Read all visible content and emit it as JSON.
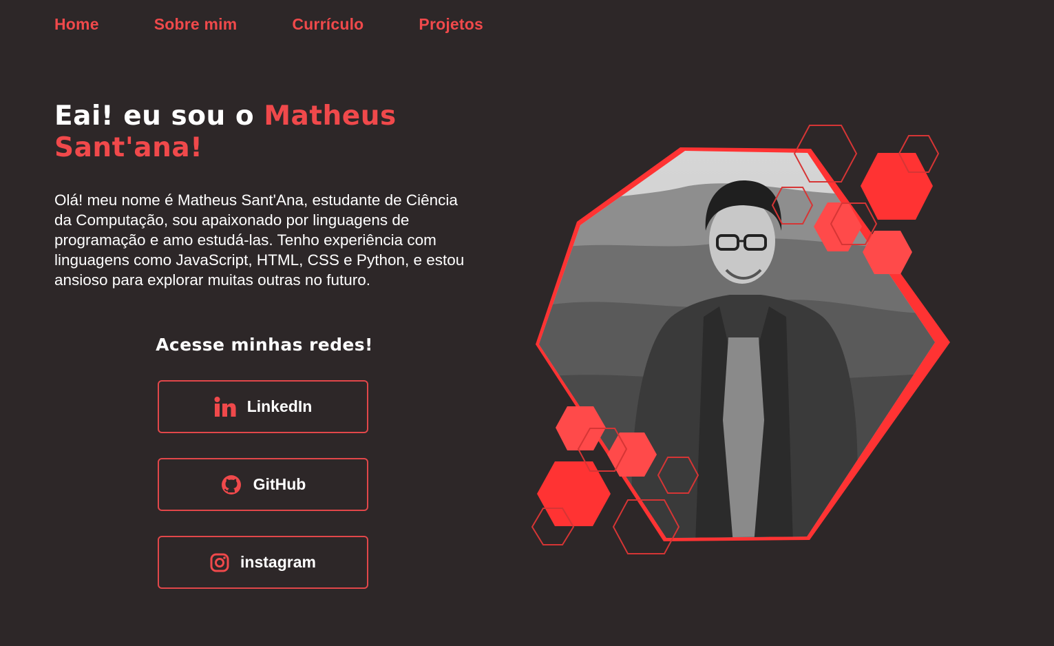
{
  "nav": {
    "items": [
      {
        "label": "Home"
      },
      {
        "label": "Sobre mim"
      },
      {
        "label": "Currículo"
      },
      {
        "label": "Projetos"
      }
    ]
  },
  "hero": {
    "title_prefix": "Eai! eu sou o ",
    "title_name": "Matheus Sant'ana!",
    "intro": "Olá! meu nome é Matheus Sant'Ana, estudante de Ciência da Computação, sou apaixonado por linguagens de programação e amo estudá-las. Tenho experiência com linguagens como JavaScript, HTML, CSS e Python, e estou ansioso para explorar muitas outras no futuro."
  },
  "social": {
    "title": "Acesse minhas redes!",
    "buttons": [
      {
        "label": "LinkedIn",
        "icon": "linkedin-icon"
      },
      {
        "label": "GitHub",
        "icon": "github-icon"
      },
      {
        "label": "instagram",
        "icon": "instagram-icon"
      }
    ]
  },
  "theme": {
    "background": "#2d2728",
    "accent": "#f0494b",
    "hexagon_red": "#ff3333",
    "text": "#ffffff"
  }
}
